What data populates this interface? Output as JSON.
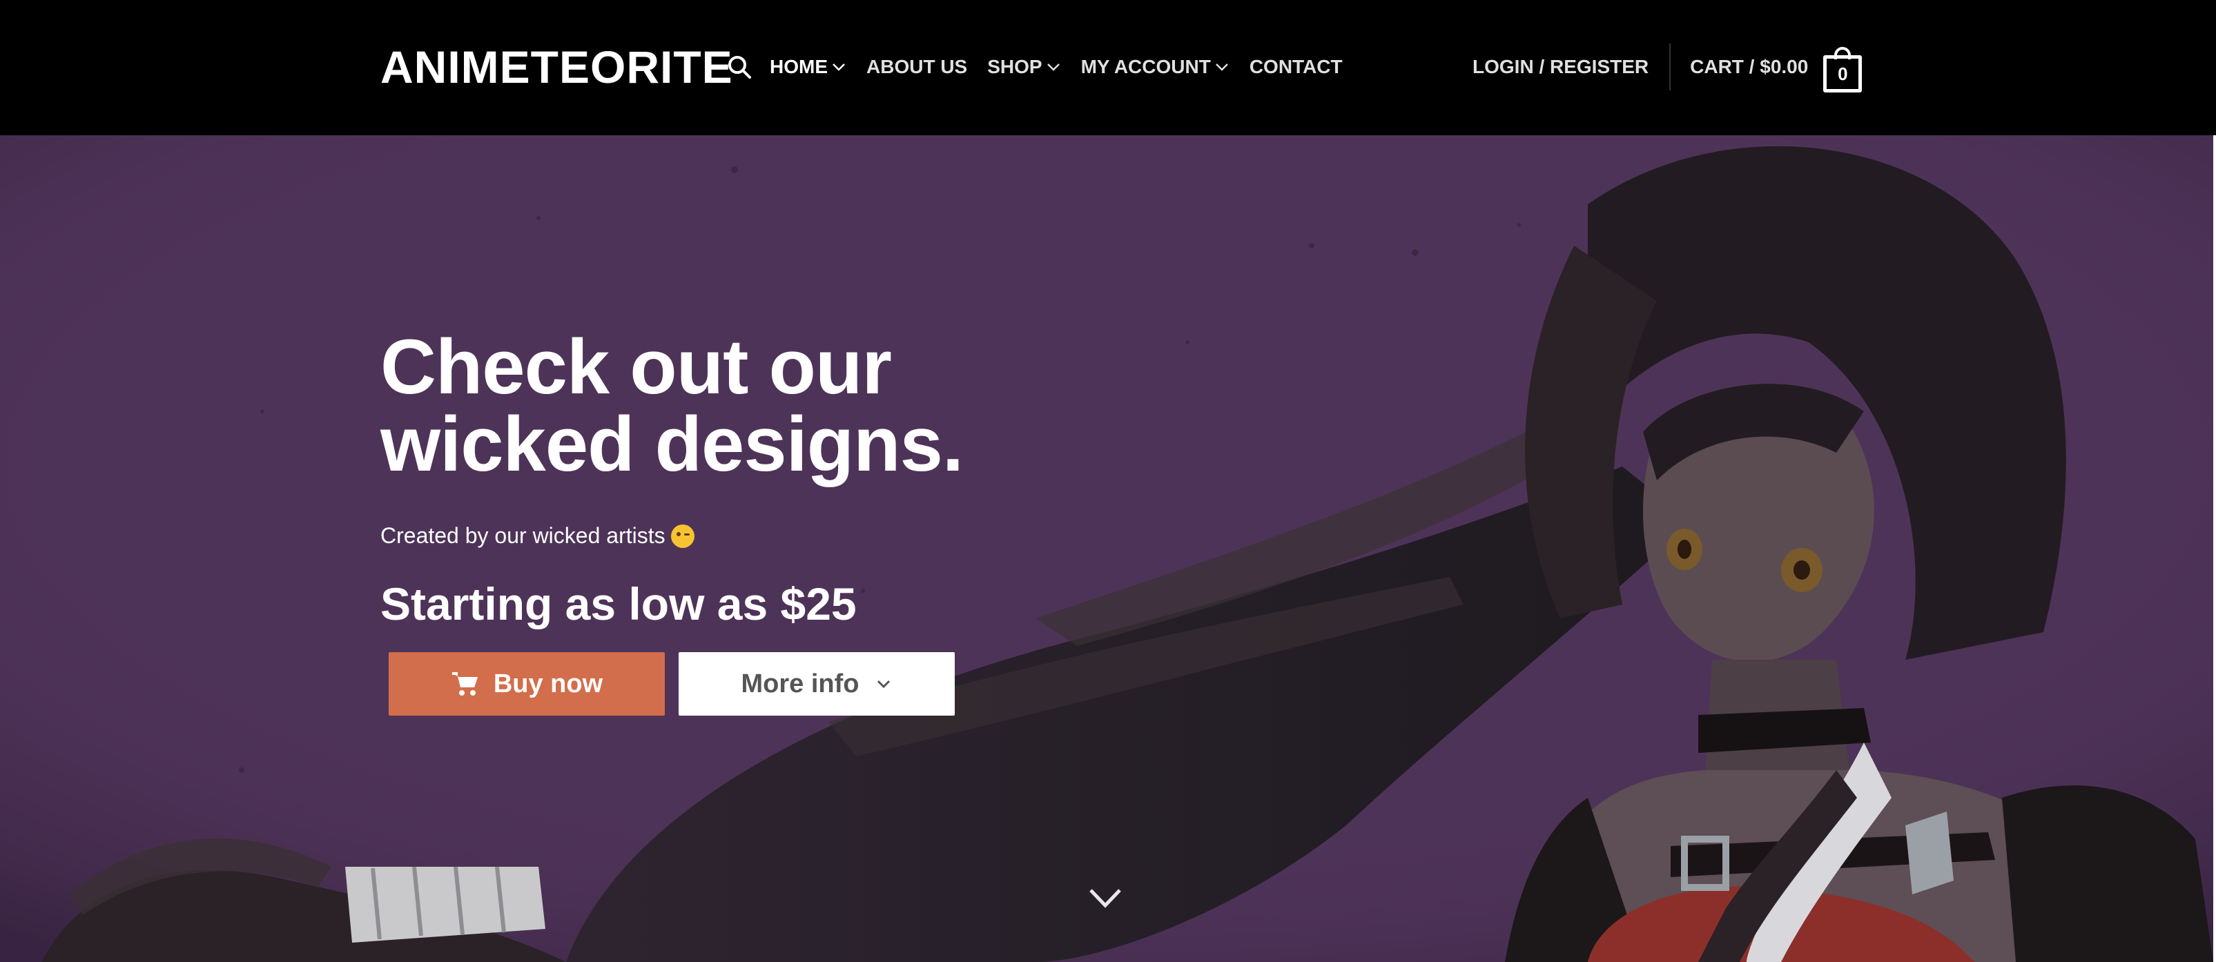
{
  "header": {
    "logo": "ANIMETEORITE",
    "nav": [
      {
        "label": "HOME",
        "has_dropdown": true,
        "active": true
      },
      {
        "label": "ABOUT US",
        "has_dropdown": false
      },
      {
        "label": "SHOP",
        "has_dropdown": true
      },
      {
        "label": "MY ACCOUNT",
        "has_dropdown": true
      },
      {
        "label": "CONTACT",
        "has_dropdown": false
      }
    ],
    "login_label": "LOGIN / REGISTER",
    "cart_label": "CART / $0.00",
    "cart_count": "0",
    "icons": {
      "search": "search-icon",
      "cart": "cart-bag-icon"
    }
  },
  "hero": {
    "heading_line1": "Check out our",
    "heading_line2": "wicked designs.",
    "subtitle": "Created by our wicked artists",
    "price_text": "Starting as low as $25",
    "buy_button": "Buy now",
    "info_button": "More info",
    "icons": {
      "buy": "cart-icon",
      "info": "chevron-down-icon",
      "scroll": "scroll-down-icon",
      "emoji": "winking-face-icon"
    }
  },
  "colors": {
    "header_bg": "#000000",
    "hero_bg": "#4e3358",
    "buy_button": "#d26e4b",
    "info_button": "#ffffff"
  }
}
